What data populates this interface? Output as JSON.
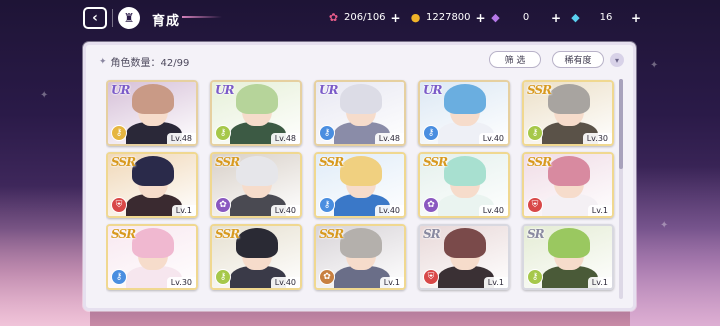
{
  "header": {
    "title": "育成"
  },
  "resources": [
    {
      "name": "candy",
      "icon": "candy-icon",
      "value": "206/106",
      "color": "#e85c8a",
      "glyph": "🍬"
    },
    {
      "name": "gold",
      "icon": "gold-coin-icon",
      "value": "1227800",
      "color": "#f0b429",
      "glyph": "●"
    },
    {
      "name": "gem-purple",
      "icon": "purple-gem-icon",
      "value": "0",
      "color": "#b678e8",
      "glyph": "◆"
    },
    {
      "name": "gem-blue",
      "icon": "blue-gem-icon",
      "value": "16",
      "color": "#5ad0f0",
      "glyph": "◆"
    }
  ],
  "panel": {
    "count_label": "角色数量：42/99",
    "filter_label": "筛 选",
    "rarity_label": "稀有度",
    "sort_icon": "chevron-down-icon"
  },
  "characters": [
    {
      "rarity": "UR",
      "level": "Lv.48",
      "element": "key-icon",
      "elem_color": "#e6b640",
      "hair": "#c99a86",
      "body": "#2a2838",
      "bg": "#d6c0d8"
    },
    {
      "rarity": "UR",
      "level": "Lv.48",
      "element": "key-icon",
      "elem_color": "#a6c84a",
      "hair": "#b6d49a",
      "body": "#3c5a44",
      "bg": "#e6f0d8"
    },
    {
      "rarity": "UR",
      "level": "Lv.48",
      "element": "key-icon",
      "elem_color": "#4a8ee0",
      "hair": "#dcdce6",
      "body": "#8a8ca8",
      "bg": "#e8e8f2"
    },
    {
      "rarity": "UR",
      "level": "Lv.40",
      "element": "key-icon",
      "elem_color": "#4a8ee0",
      "hair": "#6aaee0",
      "body": "#eef0f6",
      "bg": "#dce8f4"
    },
    {
      "rarity": "SSR",
      "level": "Lv.30",
      "element": "key-icon",
      "elem_color": "#a6c84a",
      "hair": "#a8a4a0",
      "body": "#5a5248",
      "bg": "#ece0c8"
    },
    {
      "rarity": "SSR",
      "level": "Lv.1",
      "element": "shield-icon",
      "elem_color": "#d84848",
      "hair": "#2a2a4a",
      "body": "#3a2a30",
      "bg": "#f0d8b8"
    },
    {
      "rarity": "SSR",
      "level": "Lv.40",
      "element": "flower-icon",
      "elem_color": "#8a58c0",
      "hair": "#e6e6ea",
      "body": "#4a4a52",
      "bg": "#d8d0c8"
    },
    {
      "rarity": "SSR",
      "level": "Lv.40",
      "element": "key-icon",
      "elem_color": "#4a8ee0",
      "hair": "#f0d080",
      "body": "#3a78c8",
      "bg": "#e0ecf8"
    },
    {
      "rarity": "SSR",
      "level": "Lv.40",
      "element": "flower-icon",
      "elem_color": "#8a58c0",
      "hair": "#a8e0d0",
      "body": "#eaf4f0",
      "bg": "#e4f0ec"
    },
    {
      "rarity": "SSR",
      "level": "Lv.1",
      "element": "shield-icon",
      "elem_color": "#d84848",
      "hair": "#d88aa0",
      "body": "#f4f0f4",
      "bg": "#f0dce6"
    },
    {
      "rarity": "SSR",
      "level": "Lv.30",
      "element": "key-icon",
      "elem_color": "#4a8ee0",
      "hair": "#f0b8d0",
      "body": "#f6e6ee",
      "bg": "#f8e8f0"
    },
    {
      "rarity": "SSR",
      "level": "Lv.40",
      "element": "key-icon",
      "elem_color": "#a6c84a",
      "hair": "#2a2a34",
      "body": "#3a3a48",
      "bg": "#e6e0d0"
    },
    {
      "rarity": "SSR",
      "level": "Lv.1",
      "element": "flower-icon",
      "elem_color": "#c88040",
      "hair": "#b4b0ac",
      "body": "#6a6e88",
      "bg": "#d8d4d8"
    },
    {
      "rarity": "SR",
      "level": "Lv.1",
      "element": "shield-icon",
      "elem_color": "#d84848",
      "hair": "#7a4a4a",
      "body": "#3a3034",
      "bg": "#e8d8d8"
    },
    {
      "rarity": "SR",
      "level": "Lv.1",
      "element": "key-icon",
      "elem_color": "#a6c84a",
      "hair": "#9ac860",
      "body": "#4a5a38",
      "bg": "#e4ecd4"
    }
  ]
}
